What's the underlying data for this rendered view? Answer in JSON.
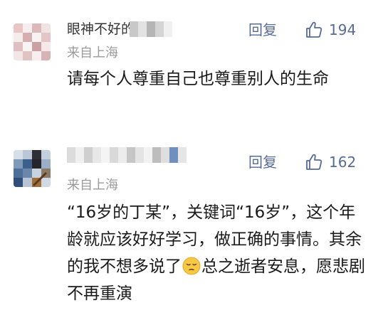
{
  "comments": [
    {
      "username": "眼神不好的猪",
      "location": "来自上海",
      "reply_label": "回复",
      "like_count": "194",
      "text": "请每个人尊重自己也尊重别人的生命",
      "avatar_colors": [
        "#e9c8c8",
        "#f4ecec",
        "#d9b5b8",
        "#cfa7a9",
        "#f7f1f1",
        "#e2c6c7"
      ]
    },
    {
      "username": "",
      "location": "来自上海",
      "reply_label": "回复",
      "like_count": "162",
      "text_before_emoji": "“16岁的丁某”，关键词“16岁”，这个年龄就应该好好学习，做正确的事情。其余的我不想多说了",
      "emoji_name": "pensive-face-emoji",
      "text_after_emoji": "总之逝者安息，愿悲剧不再重演",
      "avatar_colors": [
        "#3b5d8a",
        "#9fb6d1",
        "#2e2e34",
        "#6b87aa",
        "#b9c6d6",
        "#8a7a63"
      ]
    }
  ],
  "colors": {
    "link": "#576b95",
    "meta": "#9a9a9a",
    "text": "#1a1a1a"
  }
}
